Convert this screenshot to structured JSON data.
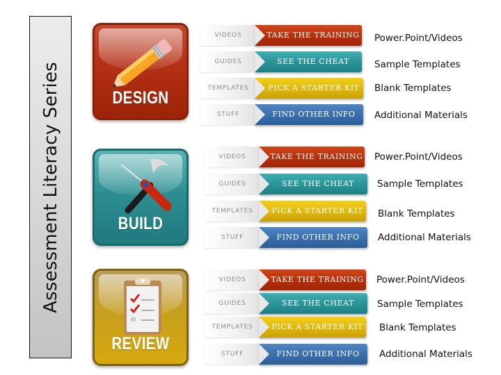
{
  "side_title": "Assessment Literacy Series",
  "sections": [
    {
      "name": "design",
      "tile_label": "DESIGN",
      "tile_icon": "pencil-icon",
      "rows": [
        {
          "tab": "VIDEOS",
          "action": "TAKE THE TRAINING",
          "color": "red",
          "description": "Power.Point/Videos"
        },
        {
          "tab": "GUIDES",
          "action": "SEE THE CHEAT SHEETS",
          "color": "teal",
          "description": "Sample Templates"
        },
        {
          "tab": "TEMPLATES",
          "action": "PICK A STARTER KIT",
          "color": "yellow",
          "description": "Blank Templates"
        },
        {
          "tab": "STUFF",
          "action": "FIND OTHER INFO",
          "color": "blue",
          "description": "Additional Materials"
        }
      ]
    },
    {
      "name": "build",
      "tile_label": "BUILD",
      "tile_icon": "tools-icon",
      "rows": [
        {
          "tab": "VIDEOS",
          "action": "TAKE THE TRAINING",
          "color": "red",
          "description": "Power.Point/Videos"
        },
        {
          "tab": "GUIDES",
          "action": "SEE THE CHEAT SHEETS",
          "color": "teal",
          "description": "Sample Templates"
        },
        {
          "tab": "TEMPLATES",
          "action": "PICK A STARTER KIT",
          "color": "yellow",
          "description": "Blank Templates"
        },
        {
          "tab": "STUFF",
          "action": "FIND OTHER INFO",
          "color": "blue",
          "description": "Additional Materials"
        }
      ]
    },
    {
      "name": "review",
      "tile_label": "REVIEW",
      "tile_icon": "clipboard-checklist-icon",
      "rows": [
        {
          "tab": "VIDEOS",
          "action": "TAKE THE TRAINING",
          "color": "red",
          "description": "Power.Point/Videos"
        },
        {
          "tab": "GUIDES",
          "action": "SEE THE CHEAT SHEETS",
          "color": "teal",
          "description": "Sample Templates"
        },
        {
          "tab": "TEMPLATES",
          "action": "PICK A STARTER KIT",
          "color": "yellow",
          "description": "Blank Templates"
        },
        {
          "tab": "STUFF",
          "action": "FIND OTHER INFO",
          "color": "blue",
          "description": "Additional Materials"
        }
      ]
    }
  ],
  "colors": {
    "red": "#b8300c",
    "teal": "#2a9599",
    "yellow": "#e2b90a",
    "blue": "#3a6fae"
  }
}
